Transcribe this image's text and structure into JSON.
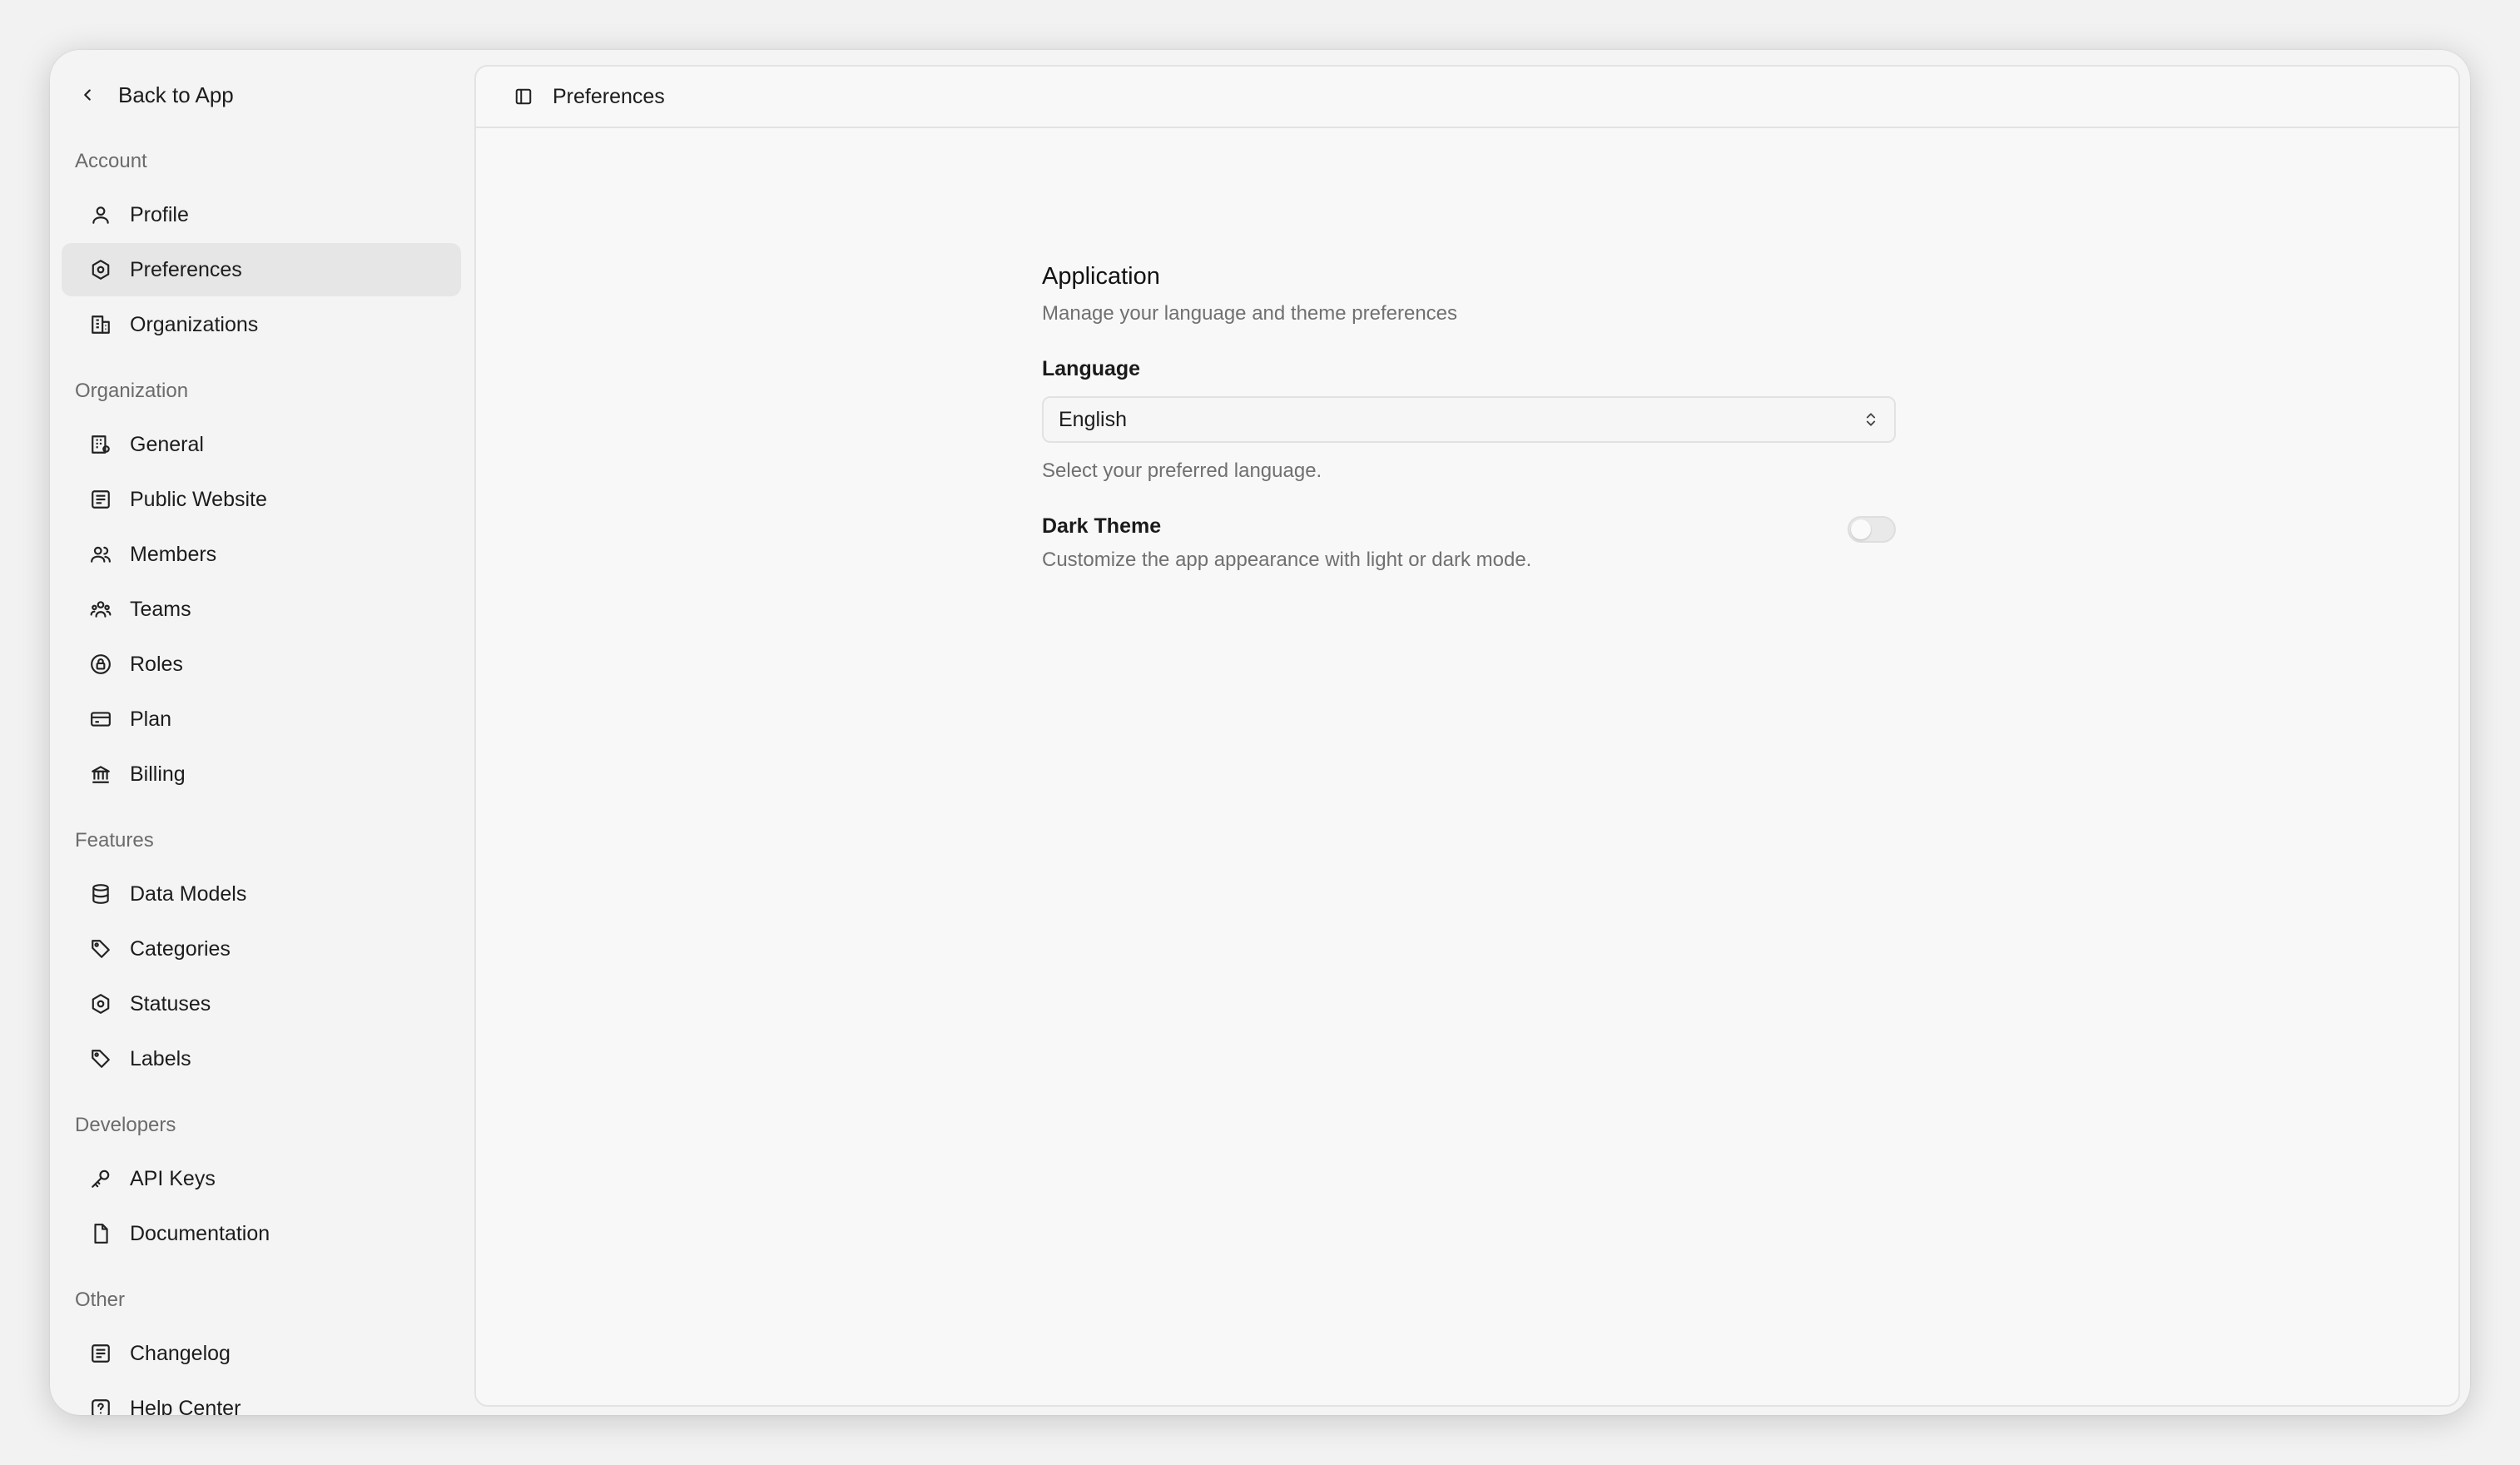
{
  "sidebar": {
    "back_label": "Back to App",
    "sections": {
      "account": "Account",
      "organization": "Organization",
      "features": "Features",
      "developers": "Developers",
      "other": "Other"
    },
    "items": {
      "profile": "Profile",
      "preferences": "Preferences",
      "organizations": "Organizations",
      "general": "General",
      "public_website": "Public Website",
      "members": "Members",
      "teams": "Teams",
      "roles": "Roles",
      "plan": "Plan",
      "billing": "Billing",
      "data_models": "Data Models",
      "categories": "Categories",
      "statuses": "Statuses",
      "labels": "Labels",
      "api_keys": "API Keys",
      "documentation": "Documentation",
      "changelog": "Changelog",
      "help_center": "Help Center"
    },
    "active_item": "preferences"
  },
  "header": {
    "title": "Preferences"
  },
  "application": {
    "title": "Application",
    "description": "Manage your language and theme preferences",
    "language_label": "Language",
    "language_value": "English",
    "language_helper": "Select your preferred language.",
    "dark_theme_label": "Dark Theme",
    "dark_theme_description": "Customize the app appearance with light or dark mode.",
    "dark_theme_enabled": false
  },
  "icons": {
    "back": "chevron-left-icon",
    "sidebar_toggle": "panel-left-icon",
    "select": "chevrons-up-down-icon"
  }
}
